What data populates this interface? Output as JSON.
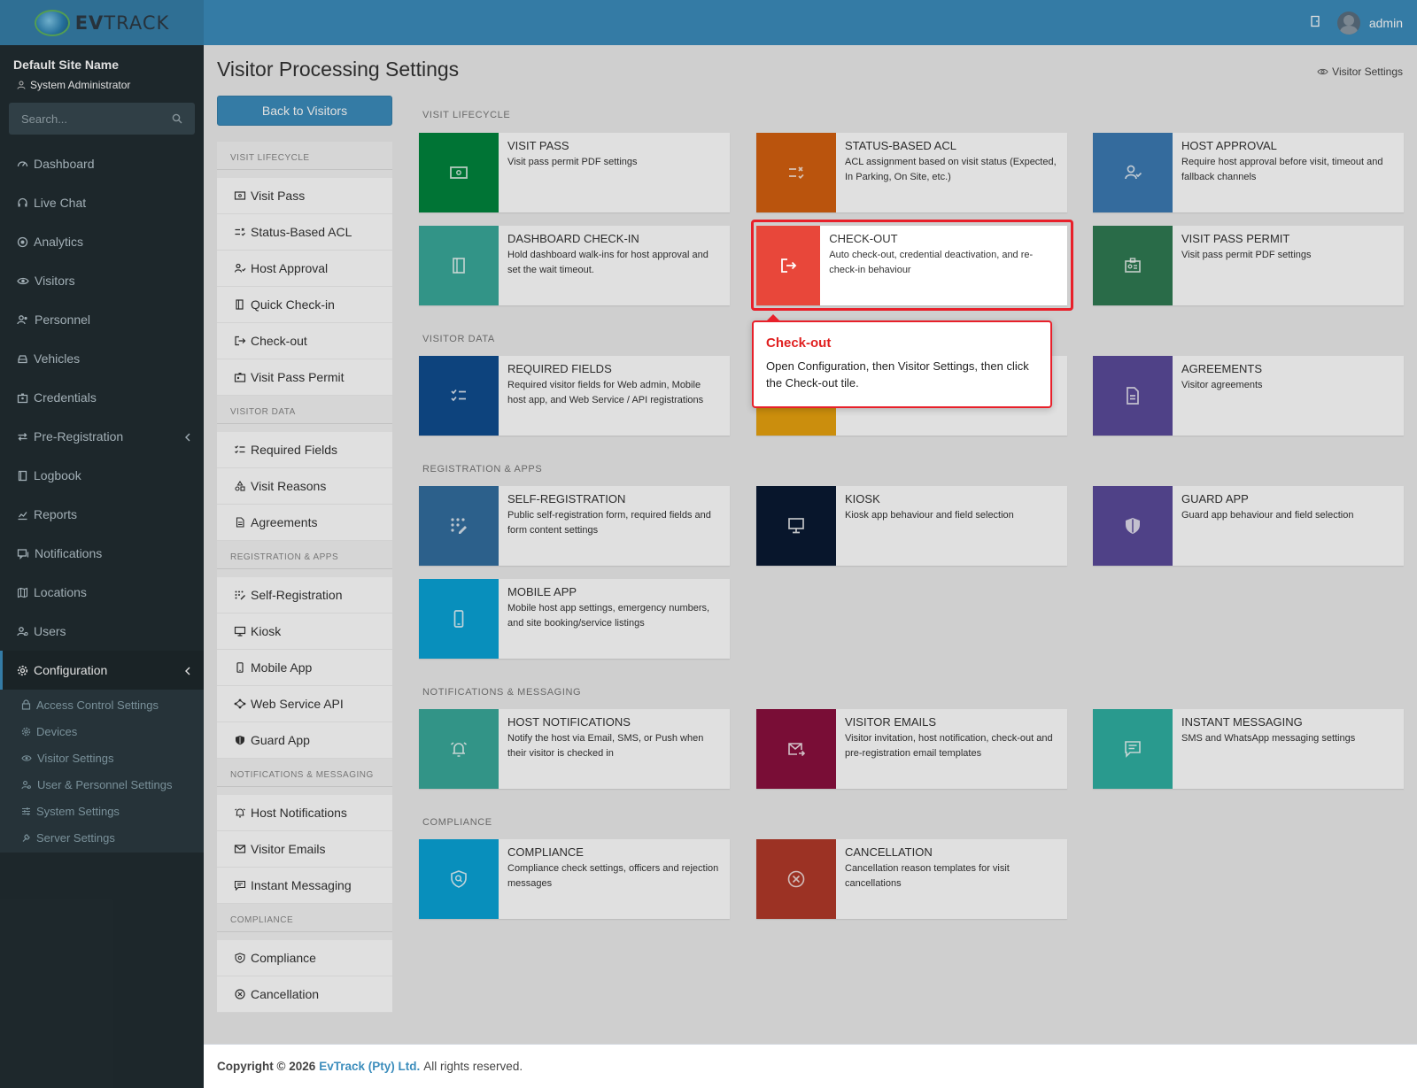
{
  "brand": {
    "logo_text_bold": "EV",
    "logo_text": "TRACK"
  },
  "header": {
    "user": "admin"
  },
  "sidebar": {
    "site_name": "Default Site Name",
    "role": "System Administrator",
    "search_placeholder": "Search...",
    "items": [
      {
        "label": "Dashboard",
        "icon": "dashboard-icon"
      },
      {
        "label": "Live Chat",
        "icon": "headset-icon"
      },
      {
        "label": "Analytics",
        "icon": "analytics-icon"
      },
      {
        "label": "Visitors",
        "icon": "eye-icon"
      },
      {
        "label": "Personnel",
        "icon": "users-icon"
      },
      {
        "label": "Vehicles",
        "icon": "car-icon"
      },
      {
        "label": "Credentials",
        "icon": "badge-icon"
      },
      {
        "label": "Pre-Registration",
        "icon": "swap-icon"
      },
      {
        "label": "Logbook",
        "icon": "book-icon"
      },
      {
        "label": "Reports",
        "icon": "chart-icon"
      },
      {
        "label": "Notifications",
        "icon": "message-icon"
      },
      {
        "label": "Locations",
        "icon": "map-icon"
      },
      {
        "label": "Users",
        "icon": "user-icon"
      },
      {
        "label": "Configuration",
        "icon": "gear-icon"
      }
    ],
    "config_sub": [
      {
        "label": "Access Control Settings",
        "icon": "lock-icon"
      },
      {
        "label": "Devices",
        "icon": "gear-icon"
      },
      {
        "label": "Visitor Settings",
        "icon": "eye-icon"
      },
      {
        "label": "User & Personnel Settings",
        "icon": "users-icon"
      },
      {
        "label": "System Settings",
        "icon": "sliders-icon"
      },
      {
        "label": "Server Settings",
        "icon": "wrench-icon"
      }
    ]
  },
  "page": {
    "title": "Visitor Processing Settings",
    "crumb": "Visitor Settings",
    "back_label": "Back to Visitors"
  },
  "subnav": {
    "visit_lifecycle": "Visit Lifecycle",
    "visitor_data": "Visitor Data",
    "registration_apps": "Registration & Apps",
    "notifications": "Notifications & Messaging",
    "compliance": "Compliance",
    "items": {
      "visit_pass": "Visit Pass",
      "status_acl": "Status-Based ACL",
      "host_approval": "Host Approval",
      "quick_checkin": "Quick Check-in",
      "checkout": "Check-out",
      "visit_pass_permit": "Visit Pass Permit",
      "required_fields": "Required Fields",
      "visit_reasons": "Visit Reasons",
      "agreements": "Agreements",
      "self_registration": "Self-Registration",
      "kiosk": "Kiosk",
      "mobile_app": "Mobile App",
      "web_service_api": "Web Service API",
      "guard_app": "Guard App",
      "host_notifications": "Host Notifications",
      "visitor_emails": "Visitor Emails",
      "instant_messaging": "Instant Messaging",
      "compliance": "Compliance",
      "cancellation": "Cancellation"
    }
  },
  "sections": {
    "visit_lifecycle": "Visit Lifecycle",
    "visitor_data": "Visitor Data",
    "registration_apps": "Registration & Apps",
    "notifications": "Notifications & Messaging",
    "compliance": "Compliance"
  },
  "tiles": {
    "visit_pass": {
      "title": "Visit Pass",
      "desc": "Visit pass permit PDF settings",
      "color": "#00843d"
    },
    "status_acl": {
      "title": "Status-Based ACL",
      "desc": "ACL assignment based on visit status (Expected, In Parking, On Site, etc.)",
      "color": "#d4600f"
    },
    "host_approval": {
      "title": "Host Approval",
      "desc": "Require host approval before visit, timeout and fallback channels",
      "color": "#3c7ab3"
    },
    "dashboard_checkin": {
      "title": "Dashboard Check-in",
      "desc": "Hold dashboard walk-ins for host approval and set the wait timeout.",
      "color": "#39a99a"
    },
    "checkout": {
      "title": "Check-out",
      "desc": "Auto check-out, credential deactivation, and re-check-in behaviour",
      "color": "#e8473a"
    },
    "visit_pass_permit": {
      "title": "Visit Pass Permit",
      "desc": "Visit pass permit PDF settings",
      "color": "#2f7a53"
    },
    "required_fields": {
      "title": "Required Fields",
      "desc": "Required visitor fields for Web admin, Mobile host app, and Web Service / API registrations",
      "color": "#0f4d8f"
    },
    "agreements": {
      "title": "Agreements",
      "desc": "Visitor agreements",
      "color": "#5a4a9a"
    },
    "self_registration": {
      "title": "Self-Registration",
      "desc": "Public self-registration form, required fields and form content settings",
      "color": "#336e9f"
    },
    "kiosk": {
      "title": "Kiosk",
      "desc": "Kiosk app behaviour and field selection",
      "color": "#0a1a33"
    },
    "guard_app": {
      "title": "Guard App",
      "desc": "Guard app behaviour and field selection",
      "color": "#5a4a9a"
    },
    "mobile_app": {
      "title": "Mobile App",
      "desc": "Mobile host app settings, emergency numbers, and site booking/service listings",
      "color": "#0aa3d6"
    },
    "host_notifications": {
      "title": "Host Notifications",
      "desc": "Notify the host via Email, SMS, or Push when their visitor is checked in",
      "color": "#39a99a"
    },
    "visitor_emails": {
      "title": "Visitor Emails",
      "desc": "Visitor invitation, host notification, check-out and pre-registration email templates",
      "color": "#8a0f3e"
    },
    "instant_messaging": {
      "title": "Instant Messaging",
      "desc": "SMS and WhatsApp messaging settings",
      "color": "#2fb0a2"
    },
    "compliance": {
      "title": "Compliance",
      "desc": "Compliance check settings, officers and rejection messages",
      "color": "#0aa3d6"
    },
    "cancellation": {
      "title": "Cancellation",
      "desc": "Cancellation reason templates for visit cancellations",
      "color": "#b23a2a"
    }
  },
  "callout": {
    "title": "Check-out",
    "text": "Open Configuration, then Visitor Settings, then click the Check-out tile."
  },
  "footer": {
    "prefix": "Copyright © 2026",
    "company": "EvTrack (Pty) Ltd.",
    "suffix": "All rights reserved."
  }
}
